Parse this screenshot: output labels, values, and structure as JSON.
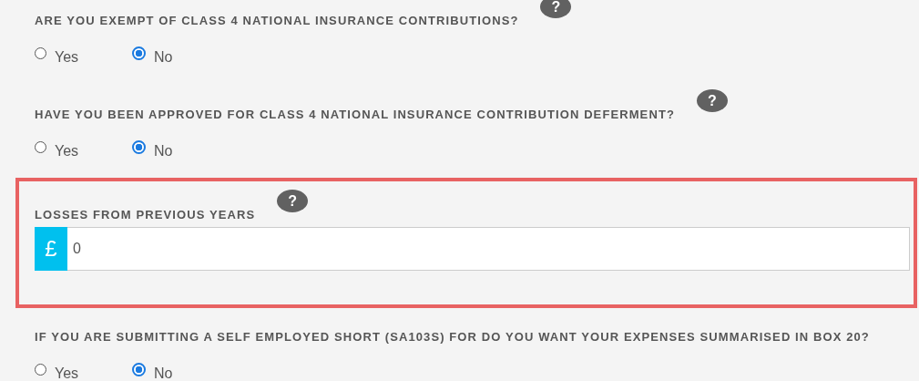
{
  "questions": [
    {
      "kind": "radio",
      "label": "ARE YOU EXEMPT OF CLASS 4 NATIONAL INSURANCE CONTRIBUTIONS?",
      "help": "?",
      "highlighted": false,
      "options": [
        {
          "label": "Yes",
          "selected": false
        },
        {
          "label": "No",
          "selected": true
        }
      ]
    },
    {
      "kind": "radio",
      "label": "HAVE YOU BEEN APPROVED FOR CLASS 4 NATIONAL INSURANCE CONTRIBUTION DEFERMENT?",
      "help": "?",
      "highlighted": false,
      "options": [
        {
          "label": "Yes",
          "selected": false
        },
        {
          "label": "No",
          "selected": true
        }
      ]
    },
    {
      "kind": "currency",
      "label": "LOSSES FROM PREVIOUS YEARS",
      "help": "?",
      "highlighted": true,
      "currency": "£",
      "value": "0"
    },
    {
      "kind": "radio",
      "label": "IF YOU ARE SUBMITTING A SELF EMPLOYED SHORT (SA103S) FOR DO YOU WANT YOUR EXPENSES SUMMARISED IN BOX 20?",
      "highlighted": false,
      "options": [
        {
          "label": "Yes",
          "selected": false
        },
        {
          "label": "No",
          "selected": true
        }
      ]
    }
  ]
}
